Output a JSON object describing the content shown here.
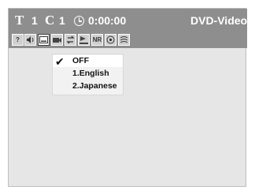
{
  "status": {
    "title_glyph": "T",
    "title_num": "1",
    "chapter_glyph": "C",
    "chapter_num": "1",
    "time": "0:00:00",
    "disc_type": "DVD-Video"
  },
  "icons": [
    {
      "name": "search-icon",
      "label": "?",
      "active": false
    },
    {
      "name": "audio-icon",
      "label": "",
      "active": false
    },
    {
      "name": "subtitle-icon",
      "label": "",
      "active": true
    },
    {
      "name": "angle-icon",
      "label": "",
      "active": false
    },
    {
      "name": "repeat-icon",
      "label": "",
      "active": false
    },
    {
      "name": "marker-icon",
      "label": "",
      "active": false
    },
    {
      "name": "noise-reduction-icon",
      "label": "NR",
      "active": false
    },
    {
      "name": "picture-icon",
      "label": "",
      "active": false
    },
    {
      "name": "surround-icon",
      "label": "",
      "active": false
    }
  ],
  "menu": {
    "options": [
      {
        "label": "OFF",
        "selected": true
      },
      {
        "label": "1.English",
        "selected": false
      },
      {
        "label": "2.Japanese",
        "selected": false
      }
    ],
    "checkmark": "✔"
  }
}
